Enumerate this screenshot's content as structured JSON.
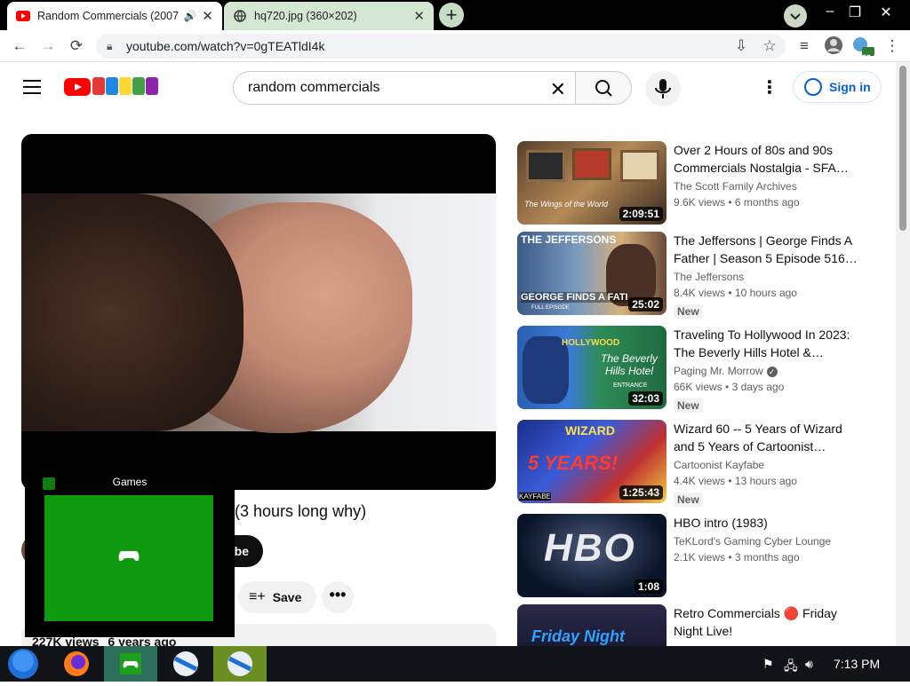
{
  "browser": {
    "tabs": [
      {
        "title": "Random Commercials (2007",
        "active": true
      },
      {
        "title": "hq720.jpg (360×202)",
        "active": false
      }
    ],
    "new_tab": "+",
    "url": "youtube.com/watch?v=0gTEATldI4k",
    "window_controls": [
      "–",
      "❐",
      "✕"
    ],
    "extension_badge": "60"
  },
  "youtube": {
    "search_value": "random commercials",
    "signin_label": "Sign in",
    "video": {
      "title": "R... (3 hours long why)",
      "title_visible_part": "(3 hours long why)",
      "subscribe_label": "be",
      "save_label": "Save",
      "more_label": "•••",
      "views": "227K views",
      "age": "6 years ago"
    },
    "recommendations": [
      {
        "title": "Over 2 Hours of 80s and 90s Commercials Nostalgia - SFA…",
        "channel": "The Scott Family Archives",
        "views": "9.6K views",
        "age": "6 months ago",
        "duration": "2:09:51",
        "badge": "",
        "verified": false
      },
      {
        "title": "The Jeffersons | George Finds A Father | Season 5 Episode 516…",
        "channel": "The Jeffersons",
        "views": "8.4K views",
        "age": "10 hours ago",
        "duration": "25:02",
        "badge": "New",
        "verified": false
      },
      {
        "title": "Traveling To Hollywood In 2023: The Beverly Hills Hotel &…",
        "channel": "Paging Mr. Morrow",
        "views": "66K views",
        "age": "3 days ago",
        "duration": "32:03",
        "badge": "New",
        "verified": true
      },
      {
        "title": "Wizard 60 -- 5 Years of Wizard and 5 Years of Cartoonist…",
        "channel": "Cartoonist Kayfabe",
        "views": "4.4K views",
        "age": "13 hours ago",
        "duration": "1:25:43",
        "badge": "New",
        "verified": false
      },
      {
        "title": "HBO intro (1983)",
        "channel": "TeKLord's Gaming Cyber Lounge",
        "views": "2.1K views",
        "age": "3 months ago",
        "duration": "1:08",
        "badge": "",
        "verified": false
      },
      {
        "title": "Retro Commercials 🔴 Friday Night Live!",
        "channel": "",
        "views": "",
        "age": "",
        "duration": "",
        "badge": "",
        "verified": false
      }
    ]
  },
  "games_overlay": {
    "title": "Games"
  },
  "taskbar": {
    "time": "7:13 PM"
  },
  "colors": {
    "youtube_red": "#ff0000",
    "link_blue": "#065fd4",
    "xbox_green": "#0e9a0e",
    "tab_inactive": "#d4e7d2"
  },
  "thumb_text": {
    "t1": "The Wings of the World",
    "t2": "THE JEFFERSONS",
    "t2b": "GEORGE FINDS A FATI",
    "t2c": "FULL EPISODE",
    "t3": "HOLLYWOOD",
    "t3b": "The Beverly Hills Hotel",
    "t3c": "ENTRANCE",
    "t4": "WIZARD",
    "t4b": "5 YEARS!",
    "t4c": "KAYFABE",
    "t5": "HBO",
    "t6": "Friday Night"
  }
}
